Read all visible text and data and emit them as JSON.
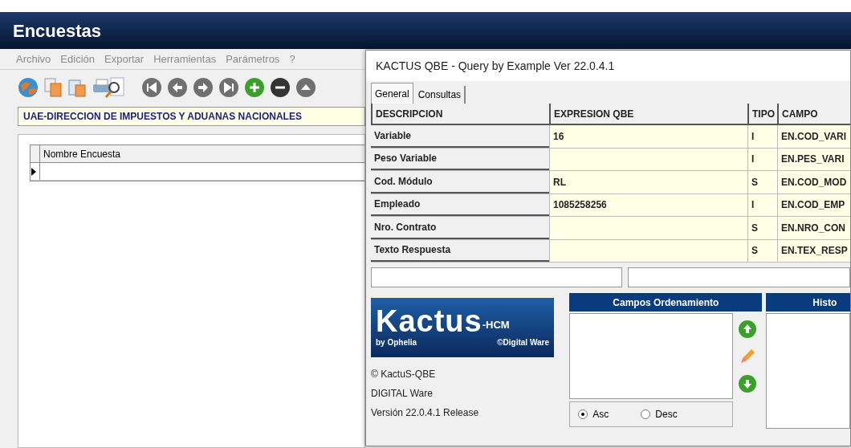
{
  "main_window": {
    "title": "Encuestas",
    "menu": [
      "Archivo",
      "Edición",
      "Exportar",
      "Herramientas",
      "Parámetros",
      "?"
    ],
    "company_field": {
      "value": "UAE-DIRECCION DE IMPUESTOS Y ADUANAS NACIONALES"
    },
    "grid": {
      "columns": [
        "Nombre Encuesta"
      ]
    }
  },
  "qbe_dialog": {
    "title": "KACTUS QBE - Query by Example Ver 22.0.4.1",
    "tabs": [
      {
        "label": "General",
        "selected": true
      },
      {
        "label": "Consultas",
        "selected": false
      }
    ],
    "table": {
      "columns": [
        "DESCRIPCION",
        "EXPRESION QBE",
        "TIPO",
        "CAMPO"
      ],
      "rows": [
        {
          "descripcion": "Variable",
          "expresion": "16",
          "tipo": "I",
          "campo": "EN.COD_VARI"
        },
        {
          "descripcion": "Peso Variable",
          "expresion": "",
          "tipo": "I",
          "campo": "EN.PES_VARI"
        },
        {
          "descripcion": "Cod. Módulo",
          "expresion": "RL",
          "tipo": "S",
          "campo": "EN.COD_MOD"
        },
        {
          "descripcion": "Empleado",
          "expresion": "1085258256",
          "tipo": "I",
          "campo": "EN.COD_EMP"
        },
        {
          "descripcion": "Nro. Contrato",
          "expresion": "",
          "tipo": "S",
          "campo": "EN.NRO_CON"
        },
        {
          "descripcion": "Texto Respuesta",
          "expresion": "",
          "tipo": "S",
          "campo": "EN.TEX_RESP"
        }
      ]
    },
    "logo": {
      "brand": "Kactus",
      "suffix": "-HCM",
      "byline": "by Ophelia",
      "maker": "©Digital Ware"
    },
    "about": [
      "© KactuS-QBE",
      "DIGITAL Ware",
      "Versión 22.0.4.1 Release"
    ],
    "sort_panel": {
      "title": "Campos Ordenamiento",
      "order": [
        {
          "label": "Asc",
          "selected": true
        },
        {
          "label": "Desc",
          "selected": false
        }
      ]
    },
    "history_panel": {
      "title": "Histo"
    }
  }
}
